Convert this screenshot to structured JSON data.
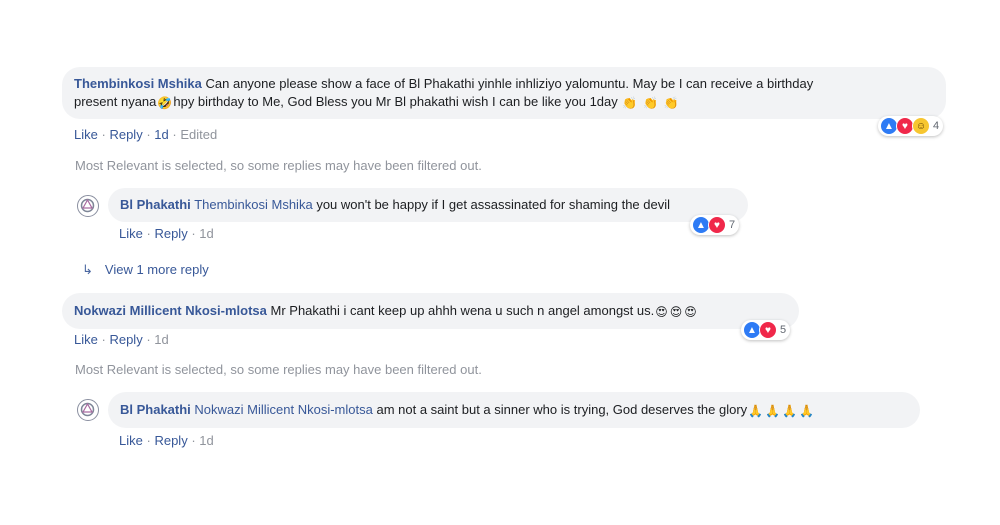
{
  "comment1": {
    "author": "Thembinkosi Mshika",
    "text_line1": "Can anyone please show a face of Bl Phakathi yinhle inhliziyo yalomuntu. May be I can receive a birthday",
    "text_line2a": "present nyana",
    "text_line2b": "hpy birthday to Me, God Bless you Mr Bl phakathi wish I can be like you 1day",
    "emoji_rofl": "🤣",
    "emoji_clap": "👏",
    "actions": {
      "like": "Like",
      "reply": "Reply",
      "time": "1d",
      "edited": "Edited"
    },
    "reaction_count": "4"
  },
  "filter_notice_1": "Most Relevant is selected, so some replies may have been filtered out.",
  "reply1": {
    "author": "Bl Phakathi",
    "mention": "Thembinkosi Mshika",
    "text": "you won't be happy if I get assassinated for shaming the devil",
    "actions": {
      "like": "Like",
      "reply": "Reply",
      "time": "1d"
    },
    "reaction_count": "7"
  },
  "view_more": "View 1 more reply",
  "comment2": {
    "author": "Nokwazi Millicent Nkosi-mlotsa",
    "text": "Mr Phakathi i cant keep up ahhh wena u such n angel amongst us.",
    "emoji": "😍",
    "actions": {
      "like": "Like",
      "reply": "Reply",
      "time": "1d"
    },
    "reaction_count": "5"
  },
  "filter_notice_2": "Most Relevant is selected, so some replies may have been filtered out.",
  "reply2": {
    "author": "Bl Phakathi",
    "mention": "Nokwazi Millicent Nkosi-mlotsa",
    "text": "am not a saint but a sinner who is trying, God deserves the glory",
    "emoji": "🙏",
    "actions": {
      "like": "Like",
      "reply": "Reply",
      "time": "1d"
    }
  },
  "colors": {
    "link": "#385898",
    "meta": "#90949c",
    "bubble": "#f2f3f5",
    "like": "#2e7bf5",
    "love": "#f0284a"
  }
}
